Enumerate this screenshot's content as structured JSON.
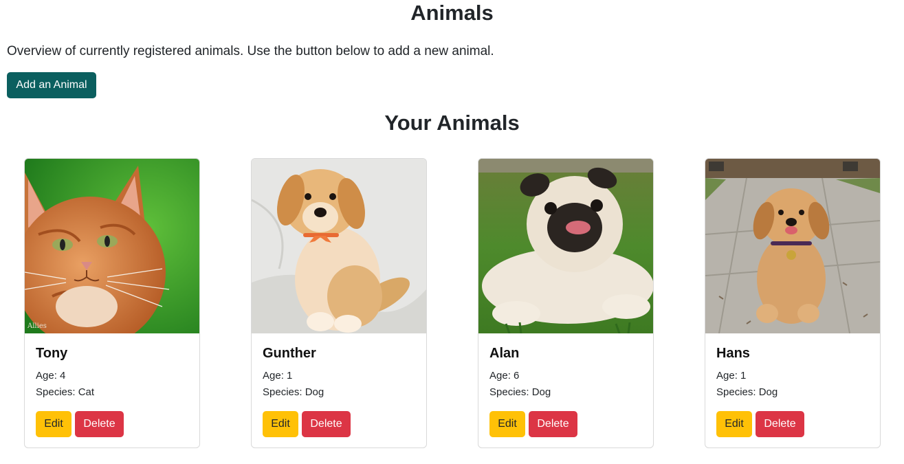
{
  "header": {
    "title": "Animals",
    "intro": "Overview of currently registered animals. Use the button below to add a new animal.",
    "add_button_label": "Add an Animal"
  },
  "section": {
    "title": "Your Animals"
  },
  "animals": [
    {
      "name": "Tony",
      "age_text": "Age: 4",
      "species_text": "Species: Cat",
      "edit_label": "Edit",
      "delete_label": "Delete",
      "photo": "orange-cat-photo",
      "watermark": "Allies"
    },
    {
      "name": "Gunther",
      "age_text": "Age: 1",
      "species_text": "Species: Dog",
      "edit_label": "Edit",
      "delete_label": "Delete",
      "photo": "golden-puppy-photo"
    },
    {
      "name": "Alan",
      "age_text": "Age: 6",
      "species_text": "Species: Dog",
      "edit_label": "Edit",
      "delete_label": "Delete",
      "photo": "pug-photo"
    },
    {
      "name": "Hans",
      "age_text": "Age: 1",
      "species_text": "Species: Dog",
      "edit_label": "Edit",
      "delete_label": "Delete",
      "photo": "golden-puppy-sidewalk-photo"
    }
  ],
  "colors": {
    "primary": "#0b5f5f",
    "warning": "#ffc107",
    "danger": "#dc3545",
    "text": "#212529",
    "card_border": "#d9d9d9"
  }
}
